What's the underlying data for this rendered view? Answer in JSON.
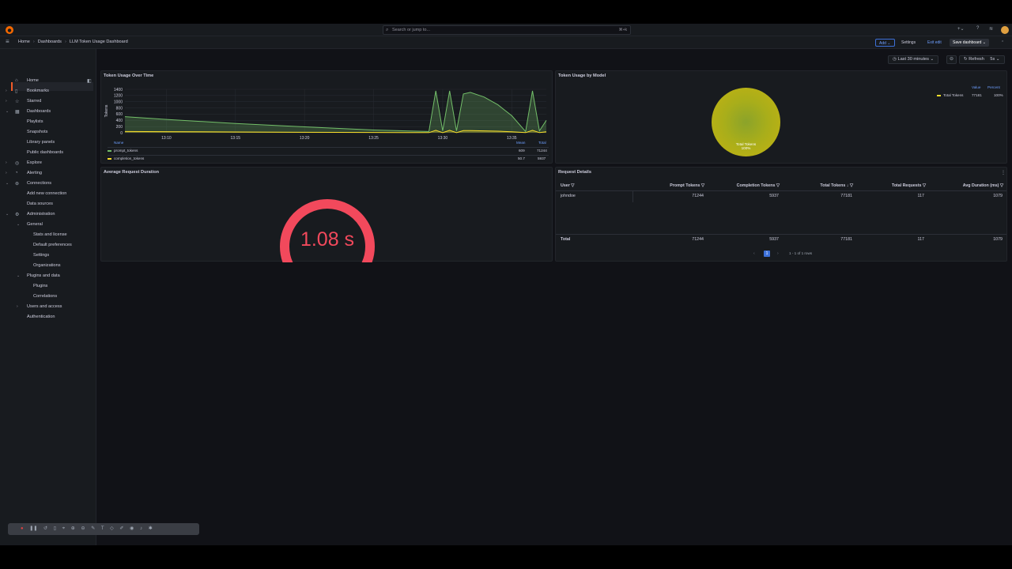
{
  "topbar": {
    "search_placeholder": "Search or jump to...",
    "search_shortcut": "⌘+k"
  },
  "breadcrumb": {
    "home": "Home",
    "dashboards": "Dashboards",
    "current": "LLM Token Usage Dashboard"
  },
  "actions": {
    "add": "Add",
    "settings": "Settings",
    "exit_edit": "Exit edit",
    "save_dashboard": "Save dashboard"
  },
  "sidebar": {
    "home": "Home",
    "bookmarks": "Bookmarks",
    "starred": "Starred",
    "dashboards": "Dashboards",
    "playlists": "Playlists",
    "snapshots": "Snapshots",
    "library_panels": "Library panels",
    "public_dashboards": "Public dashboards",
    "explore": "Explore",
    "alerting": "Alerting",
    "connections": "Connections",
    "add_new_connection": "Add new connection",
    "data_sources": "Data sources",
    "administration": "Administration",
    "general": "General",
    "stats_and_license": "Stats and license",
    "default_preferences": "Default preferences",
    "settings": "Settings",
    "organizations": "Organizations",
    "plugins_and_data": "Plugins and data",
    "plugins": "Plugins",
    "correlations": "Correlations",
    "users_and_access": "Users and access",
    "authentication": "Authentication"
  },
  "controls": {
    "time_range": "Last 30 minutes",
    "refresh": "Refresh",
    "refresh_interval": "5s"
  },
  "panels": {
    "token_usage_over_time": {
      "title": "Token Usage Over Time",
      "legend_header": {
        "name": "Name",
        "mean": "Mean",
        "total": "Total"
      },
      "legend": [
        {
          "name": "prompt_tokens",
          "mean": "609",
          "total": "71244",
          "color": "#73bf69"
        },
        {
          "name": "completion_tokens",
          "mean": "50.7",
          "total": "5937",
          "color": "#fade2a"
        }
      ]
    },
    "token_usage_by_model": {
      "title": "Token Usage by Model",
      "legend_header": {
        "value": "Value",
        "percent": "Percent"
      },
      "legend": [
        {
          "name": "Total Tokens",
          "value": "77181",
          "percent": "100%",
          "color": "#fade2a"
        }
      ],
      "slice_label": "Total Tokens",
      "slice_percent": "100%"
    },
    "avg_request_duration": {
      "title": "Average Request Duration",
      "value_text": "1.08 s",
      "value": 1.08,
      "gauge_fraction": 1.0,
      "color": "#f2495c"
    },
    "request_details": {
      "title": "Request Details",
      "columns": [
        "User",
        "Prompt Tokens",
        "Completion Tokens",
        "Total Tokens",
        "Total Requests",
        "Avg Duration (ms)"
      ],
      "rows": [
        [
          "johndoe",
          "71244",
          "5937",
          "77181",
          "117",
          "1079"
        ]
      ],
      "footer": [
        "Total",
        "71244",
        "5937",
        "77181",
        "117",
        "1079"
      ],
      "pagination": {
        "page": "1",
        "summary": "1 - 1 of 1 rows"
      }
    }
  },
  "chart_data": {
    "type": "area",
    "title": "Token Usage Over Time",
    "ylabel": "Tokens",
    "ylim": [
      0,
      1400
    ],
    "yticks": [
      "1400",
      "1200",
      "1000",
      "800",
      "600",
      "400",
      "200",
      "0"
    ],
    "xticks": [
      "13:10",
      "13:15",
      "13:20",
      "13:25",
      "13:30",
      "13:35"
    ],
    "x": [
      "13:07",
      "13:10",
      "13:15",
      "13:20",
      "13:25",
      "13:29",
      "13:29.5",
      "13:30",
      "13:30.5",
      "13:31",
      "13:31.5",
      "13:32",
      "13:33",
      "13:34",
      "13:35",
      "13:36",
      "13:36.5",
      "13:37",
      "13:37.5"
    ],
    "series": [
      {
        "name": "prompt_tokens",
        "color": "#73bf69",
        "values": [
          520,
          430,
          300,
          190,
          90,
          40,
          1350,
          60,
          1350,
          60,
          1250,
          1300,
          1150,
          900,
          550,
          40,
          1350,
          60,
          400
        ]
      },
      {
        "name": "completion_tokens",
        "color": "#fade2a",
        "values": [
          40,
          35,
          25,
          15,
          10,
          5,
          80,
          5,
          80,
          5,
          70,
          70,
          60,
          50,
          30,
          5,
          80,
          5,
          30
        ]
      }
    ]
  }
}
